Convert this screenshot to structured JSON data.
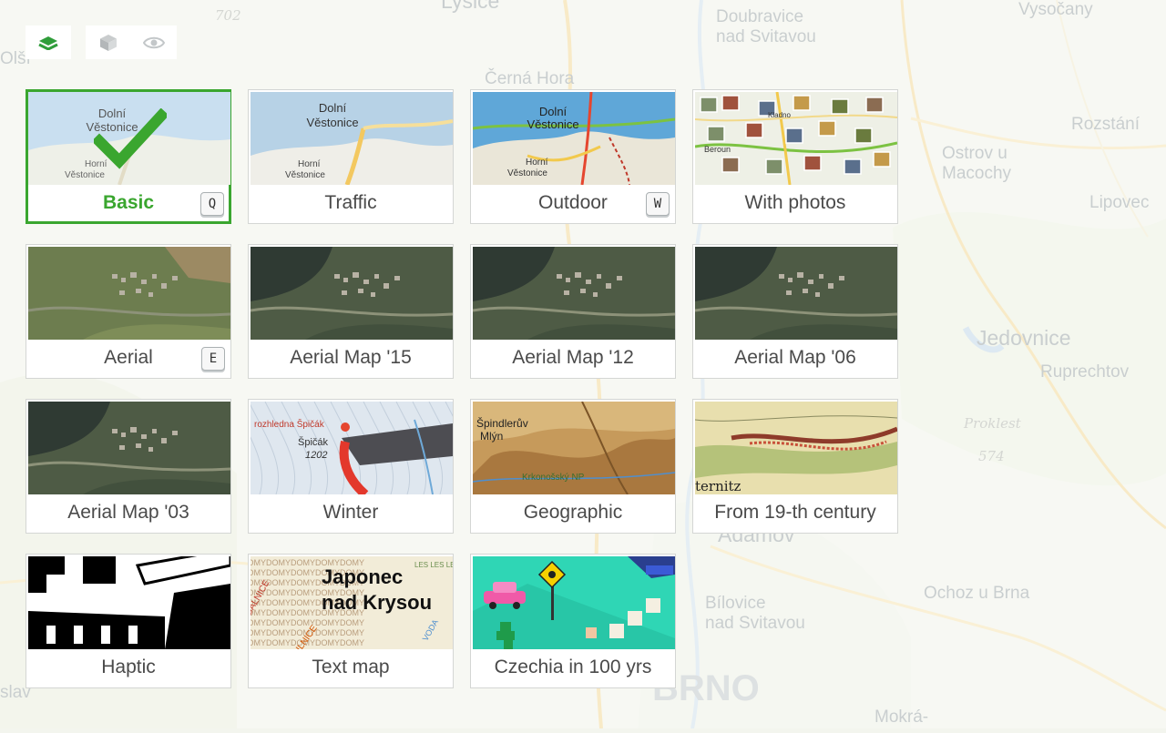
{
  "colors": {
    "accent": "#3aa62f",
    "map_bg": "#f3f5ee",
    "label": "#4a4a4a"
  },
  "map_labels": [
    {
      "name": "label-702",
      "text": "702",
      "cls": "num"
    },
    {
      "name": "label-lysice",
      "text": "Lysice",
      "cls": "mid"
    },
    {
      "name": "label-doubravice",
      "text": "Doubravice\nnad Svitavou",
      "cls": "sm ml"
    },
    {
      "name": "label-vysocany",
      "text": "Vysočany",
      "cls": "sm"
    },
    {
      "name": "label-olsi",
      "text": "Olší",
      "cls": "sm"
    },
    {
      "name": "label-cerna-hora",
      "text": "Černá Hora",
      "cls": "sm"
    },
    {
      "name": "label-rozstani",
      "text": "Rozstání",
      "cls": "sm"
    },
    {
      "name": "label-ostrov",
      "text": "Ostrov u\nMacochy",
      "cls": "sm ml"
    },
    {
      "name": "label-lipovec",
      "text": "Lipovec",
      "cls": "sm"
    },
    {
      "name": "label-jedovnice",
      "text": "Jedovnice",
      "cls": "mid"
    },
    {
      "name": "label-ruprechtov",
      "text": "Ruprechtov",
      "cls": "sm"
    },
    {
      "name": "label-proklest",
      "text": "Proklest",
      "cls": "num"
    },
    {
      "name": "label-574",
      "text": "574",
      "cls": "num"
    },
    {
      "name": "label-adamov",
      "text": "Adamov",
      "cls": "mid"
    },
    {
      "name": "label-bilovice",
      "text": "Bílovice\nnad Svitavou",
      "cls": "sm ml"
    },
    {
      "name": "label-ochoz",
      "text": "Ochoz u Brna",
      "cls": "sm"
    },
    {
      "name": "label-brno",
      "text": "BRNO",
      "cls": "big"
    },
    {
      "name": "label-mokra",
      "text": "Mokrá-",
      "cls": "sm"
    },
    {
      "name": "label-slav",
      "text": "slav",
      "cls": "sm"
    }
  ],
  "toolbar": {
    "layers_icon": "layers-icon",
    "cube_icon": "cube-3d-icon",
    "eye_icon": "eye-icon"
  },
  "tiles": [
    {
      "id": "basic",
      "label": "Basic",
      "key": "Q",
      "active": true,
      "icon": "check-icon"
    },
    {
      "id": "traffic",
      "label": "Traffic",
      "key": "",
      "active": false
    },
    {
      "id": "outdoor",
      "label": "Outdoor",
      "key": "W",
      "active": false
    },
    {
      "id": "with-photos",
      "label": "With photos",
      "key": "",
      "active": false
    },
    {
      "id": "aerial",
      "label": "Aerial",
      "key": "E",
      "active": false
    },
    {
      "id": "aerial-15",
      "label": "Aerial Map '15",
      "key": "",
      "active": false
    },
    {
      "id": "aerial-12",
      "label": "Aerial Map '12",
      "key": "",
      "active": false
    },
    {
      "id": "aerial-06",
      "label": "Aerial Map '06",
      "key": "",
      "active": false
    },
    {
      "id": "aerial-03",
      "label": "Aerial Map '03",
      "key": "",
      "active": false
    },
    {
      "id": "winter",
      "label": "Winter",
      "key": "",
      "active": false
    },
    {
      "id": "geographic",
      "label": "Geographic",
      "key": "",
      "active": false
    },
    {
      "id": "19th-century",
      "label": "From 19-th century",
      "key": "",
      "active": false
    },
    {
      "id": "haptic",
      "label": "Haptic",
      "key": "",
      "active": false
    },
    {
      "id": "text-map",
      "label": "Text map",
      "key": "",
      "active": false
    },
    {
      "id": "czechia-100",
      "label": "Czechia in 100 yrs",
      "key": "",
      "active": false
    }
  ],
  "thumb_text": {
    "dolni": "Dolní",
    "vestonice": "Věstonice",
    "horni": "Horní",
    "beroun": "Beroun",
    "kladno": "Kladno",
    "rozhledna": "rozhledna Špičák",
    "spicak": "Špičák",
    "elev": "1202",
    "spindl": "Špindlerův",
    "mlyn": "Mlýn",
    "krnap": "Krkonošský NP",
    "ternitz": "ternitz",
    "japonec": "Japonec",
    "nad_krysou": "nad Krysou",
    "domy": "DOMYDOMYDOMYDOMYDOMY",
    "silnice": "SILNICE",
    "dalnice": "DÁLNICE",
    "voda": "VODA",
    "lesles": "LES LES LES LES LES"
  }
}
